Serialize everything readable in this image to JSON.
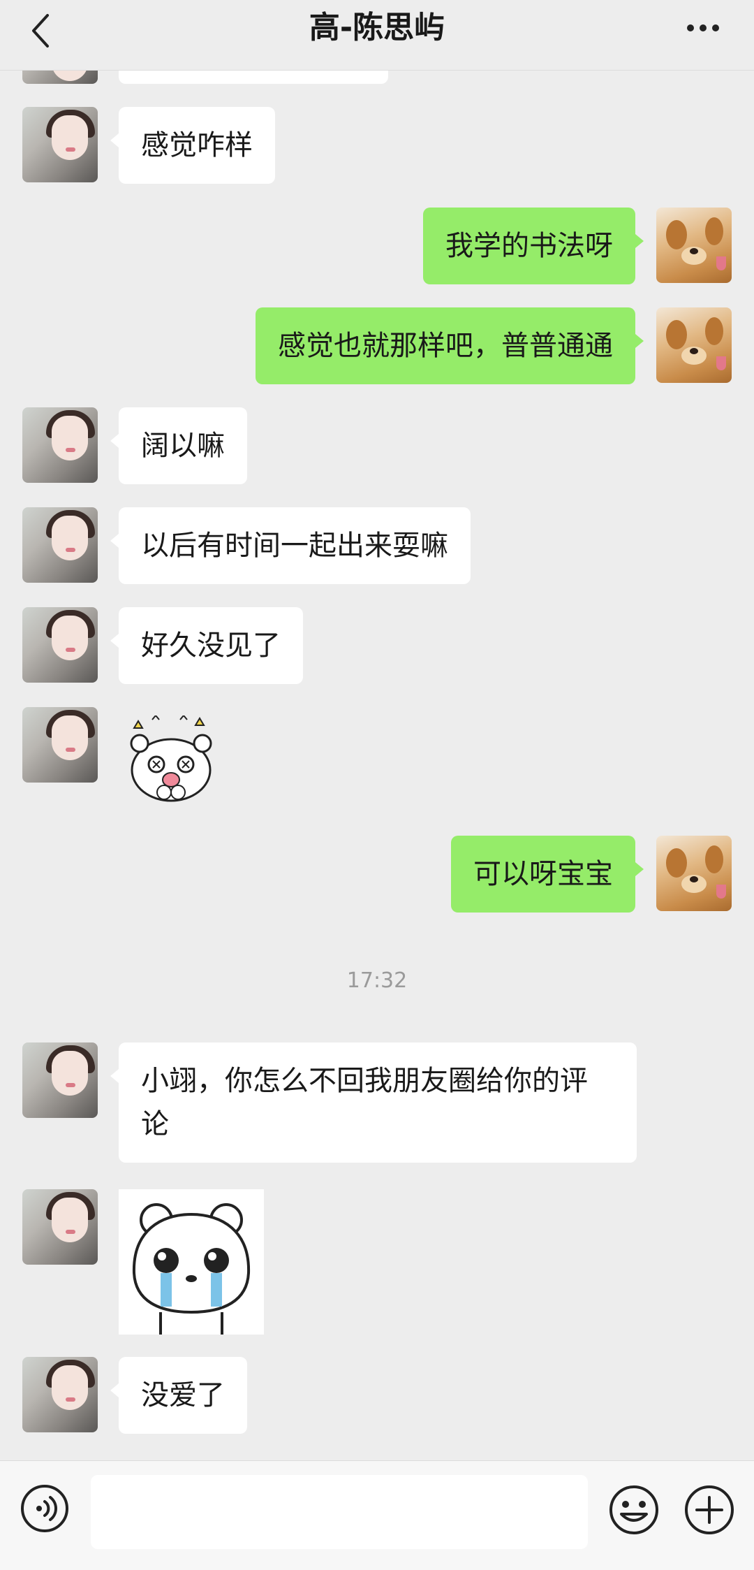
{
  "header": {
    "title": "高-陈思屿"
  },
  "messages": [
    {
      "side": "left",
      "text": "感觉咋样"
    },
    {
      "side": "right",
      "text": "我学的书法呀"
    },
    {
      "side": "right",
      "text": "感觉也就那样吧，普普通通"
    },
    {
      "side": "left",
      "text": "阔以嘛"
    },
    {
      "side": "left",
      "text": "以后有时间一起出来耍嘛"
    },
    {
      "side": "left",
      "text": "好久没见了"
    },
    {
      "side": "left",
      "sticker": "excited-bear-sticker"
    },
    {
      "side": "right",
      "text": "可以呀宝宝"
    },
    {
      "time": "17:32"
    },
    {
      "side": "left",
      "text": "小翊，你怎么不回我朋友圈给你的评论"
    },
    {
      "side": "left",
      "sticker": "crying-bear-sticker"
    },
    {
      "side": "left",
      "text": "没爱了"
    }
  ],
  "input": {
    "value": "",
    "placeholder": ""
  },
  "icons": {
    "back": "chevron-left-icon",
    "more": "more-dots-icon",
    "voice": "voice-icon",
    "emoji": "emoji-icon",
    "plus": "plus-icon"
  },
  "colors": {
    "background": "#ededed",
    "bubble_right": "#95ec69",
    "bubble_left": "#ffffff"
  }
}
